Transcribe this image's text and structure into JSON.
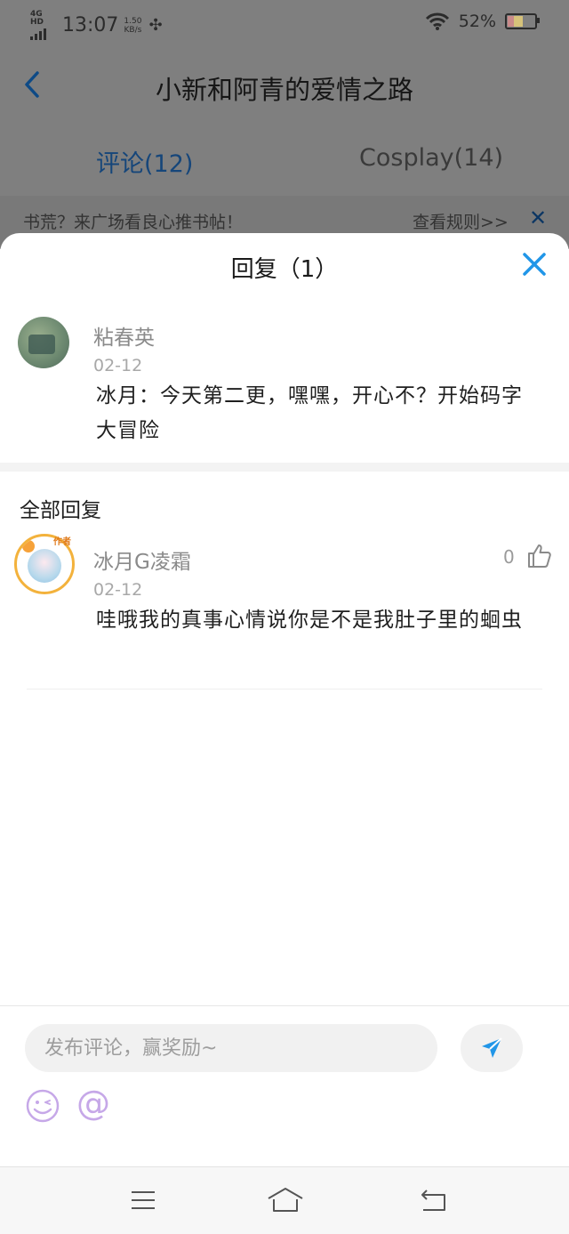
{
  "status_bar": {
    "network": "4G HD",
    "time": "13:07",
    "speed_value": "1.50",
    "speed_unit": "KB/s",
    "battery_percent": "52%"
  },
  "nav": {
    "title": "小新和阿青的爱情之路"
  },
  "tabs": [
    {
      "label": "评论(12)"
    },
    {
      "label": "Cosplay(14)"
    }
  ],
  "notice": {
    "text": "书荒？来广场看良心推书帖！",
    "link": "查看规则>>"
  },
  "sheet": {
    "title": "回复（1）",
    "original_comment": {
      "username": "粘春英",
      "date": "02-12",
      "text": "冰月：今天第二更，嘿嘿，开心不？开始码字大冒险"
    },
    "section_title": "全部回复",
    "replies": [
      {
        "username": "冰月G凌霜",
        "badge": "作者",
        "date": "02-12",
        "text": "哇哦我的真事心情说你是不是我肚子里的蛔虫",
        "likes": "0"
      }
    ]
  },
  "composer": {
    "placeholder": "发布评论，赢奖励~",
    "at_symbol": "@"
  },
  "colors": {
    "accent_blue": "#2196e8",
    "overlay_gray": "#7f7f7f",
    "emoji_purple": "#c6a8e8"
  }
}
